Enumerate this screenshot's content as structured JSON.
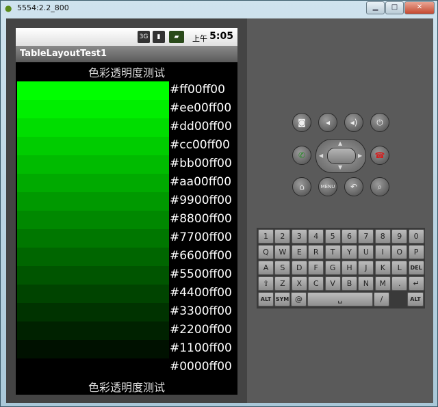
{
  "window": {
    "title": "5554:2.2_800",
    "minimize_label": "▁",
    "maximize_label": "□",
    "close_label": "✕"
  },
  "status": {
    "net_label": "3G",
    "ampm": "上午",
    "time": "5:05"
  },
  "app": {
    "title": "TableLayoutTest1",
    "caption_top": "色彩透明度测试",
    "caption_bottom": "色彩透明度测试",
    "rows": [
      {
        "code": "#ff00ff00",
        "alpha": 1.0
      },
      {
        "code": "#ee00ff00",
        "alpha": 0.933
      },
      {
        "code": "#dd00ff00",
        "alpha": 0.867
      },
      {
        "code": "#cc00ff00",
        "alpha": 0.8
      },
      {
        "code": "#bb00ff00",
        "alpha": 0.733
      },
      {
        "code": "#aa00ff00",
        "alpha": 0.667
      },
      {
        "code": "#9900ff00",
        "alpha": 0.6
      },
      {
        "code": "#8800ff00",
        "alpha": 0.533
      },
      {
        "code": "#7700ff00",
        "alpha": 0.467
      },
      {
        "code": "#6600ff00",
        "alpha": 0.4
      },
      {
        "code": "#5500ff00",
        "alpha": 0.333
      },
      {
        "code": "#4400ff00",
        "alpha": 0.267
      },
      {
        "code": "#3300ff00",
        "alpha": 0.2
      },
      {
        "code": "#2200ff00",
        "alpha": 0.133
      },
      {
        "code": "#1100ff00",
        "alpha": 0.067
      },
      {
        "code": "#0000ff00",
        "alpha": 0.0
      }
    ]
  },
  "keyboard": {
    "row1": [
      "1",
      "2",
      "3",
      "4",
      "5",
      "6",
      "7",
      "8",
      "9",
      "0"
    ],
    "row2": [
      "Q",
      "W",
      "E",
      "R",
      "T",
      "Y",
      "U",
      "I",
      "O",
      "P"
    ],
    "row3": [
      "A",
      "S",
      "D",
      "F",
      "G",
      "H",
      "J",
      "K",
      "L",
      "DEL"
    ],
    "row4": [
      "⇧",
      "Z",
      "X",
      "C",
      "V",
      "B",
      "N",
      "M",
      ".",
      "↵"
    ],
    "row5_alt": "ALT",
    "row5_sym": "SYM",
    "row5_at": "@",
    "row5_space": "␣",
    "row5_slash": "/",
    "row5_alt2": "ALT"
  },
  "hw_buttons": {
    "menu_label": "MENU"
  }
}
